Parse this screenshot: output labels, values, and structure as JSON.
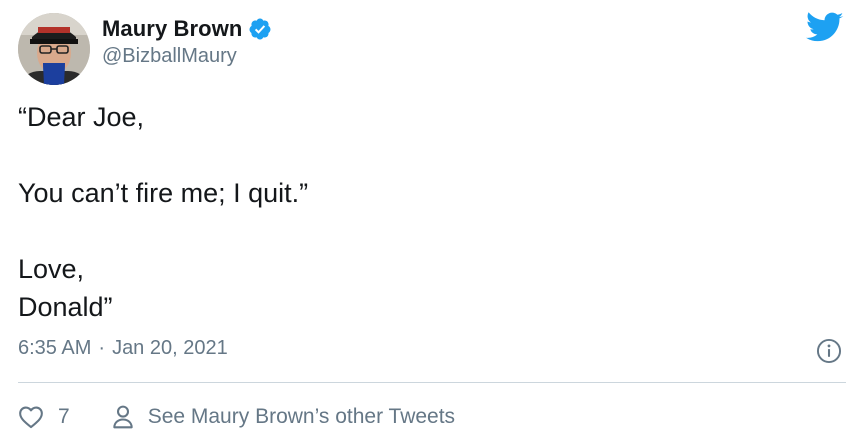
{
  "author": {
    "display_name": "Maury Brown",
    "handle": "@BizballMaury",
    "verified": true
  },
  "tweet": {
    "lines": [
      "“Dear Joe,",
      "",
      "You can’t fire me; I quit.”",
      "",
      "Love,",
      "Donald”"
    ],
    "time": "6:35 AM",
    "separator": "·",
    "date": "Jan 20, 2021"
  },
  "actions": {
    "like_count": "7",
    "other_tweets_label": "See Maury Brown’s other Tweets"
  },
  "colors": {
    "text": "#14171a",
    "secondary": "#657786",
    "twitter_blue": "#1da1f2",
    "divider": "#ccd6dd"
  },
  "icons": {
    "brand": "twitter-bird-icon",
    "verified": "verified-badge-icon",
    "info": "info-icon",
    "like": "heart-icon",
    "profile": "person-icon"
  }
}
